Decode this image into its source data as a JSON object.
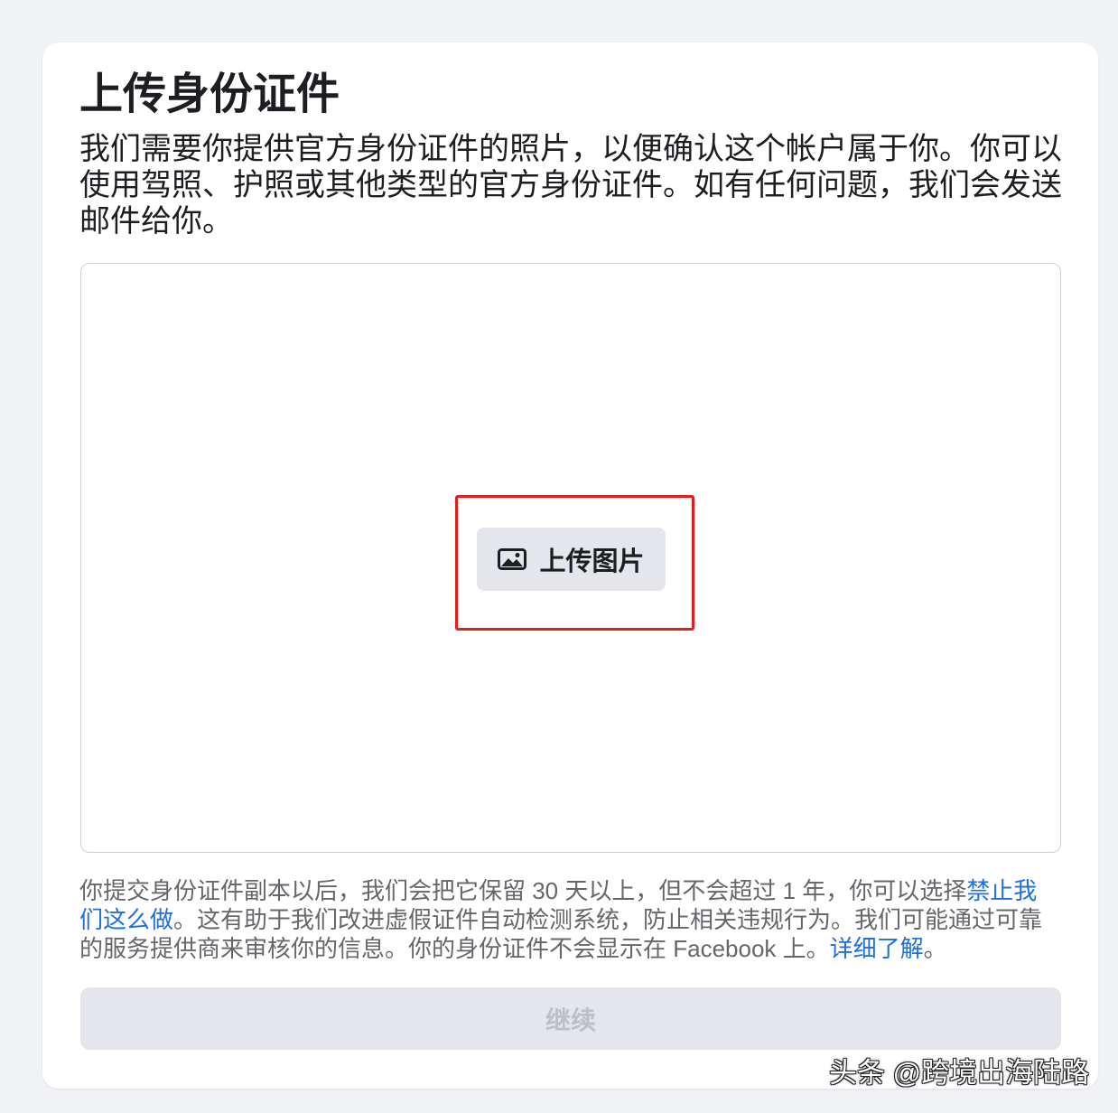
{
  "page": {
    "title": "上传身份证件",
    "description": "我们需要你提供官方身份证件的照片，以便确认这个帐户属于你。你可以使用驾照、护照或其他类型的官方身份证件。如有任何问题，我们会发送邮件给你。"
  },
  "upload": {
    "button_label": "上传图片",
    "icon": "image-icon"
  },
  "footer": {
    "text_1": "你提交身份证件副本以后，我们会把它保留 30 天以上，但不会超过 1 年，你可以选择",
    "link_1": "禁止我们这么做",
    "text_2": "。这有助于我们改进虚假证件自动检测系统，防止相关违规行为。我们可能通过可靠的服务提供商来审核你的信息。你的身份证件不会显示在 Facebook 上。",
    "link_2": "详细了解",
    "text_3": "。"
  },
  "continue_button": {
    "label": "继续",
    "disabled": true
  },
  "watermark": {
    "text": "头条 @跨境出海陆路"
  },
  "colors": {
    "link": "#216fdb",
    "button_bg": "#e4e6eb",
    "highlight": "#e0201f",
    "disabled_text": "#bcc0c4"
  }
}
